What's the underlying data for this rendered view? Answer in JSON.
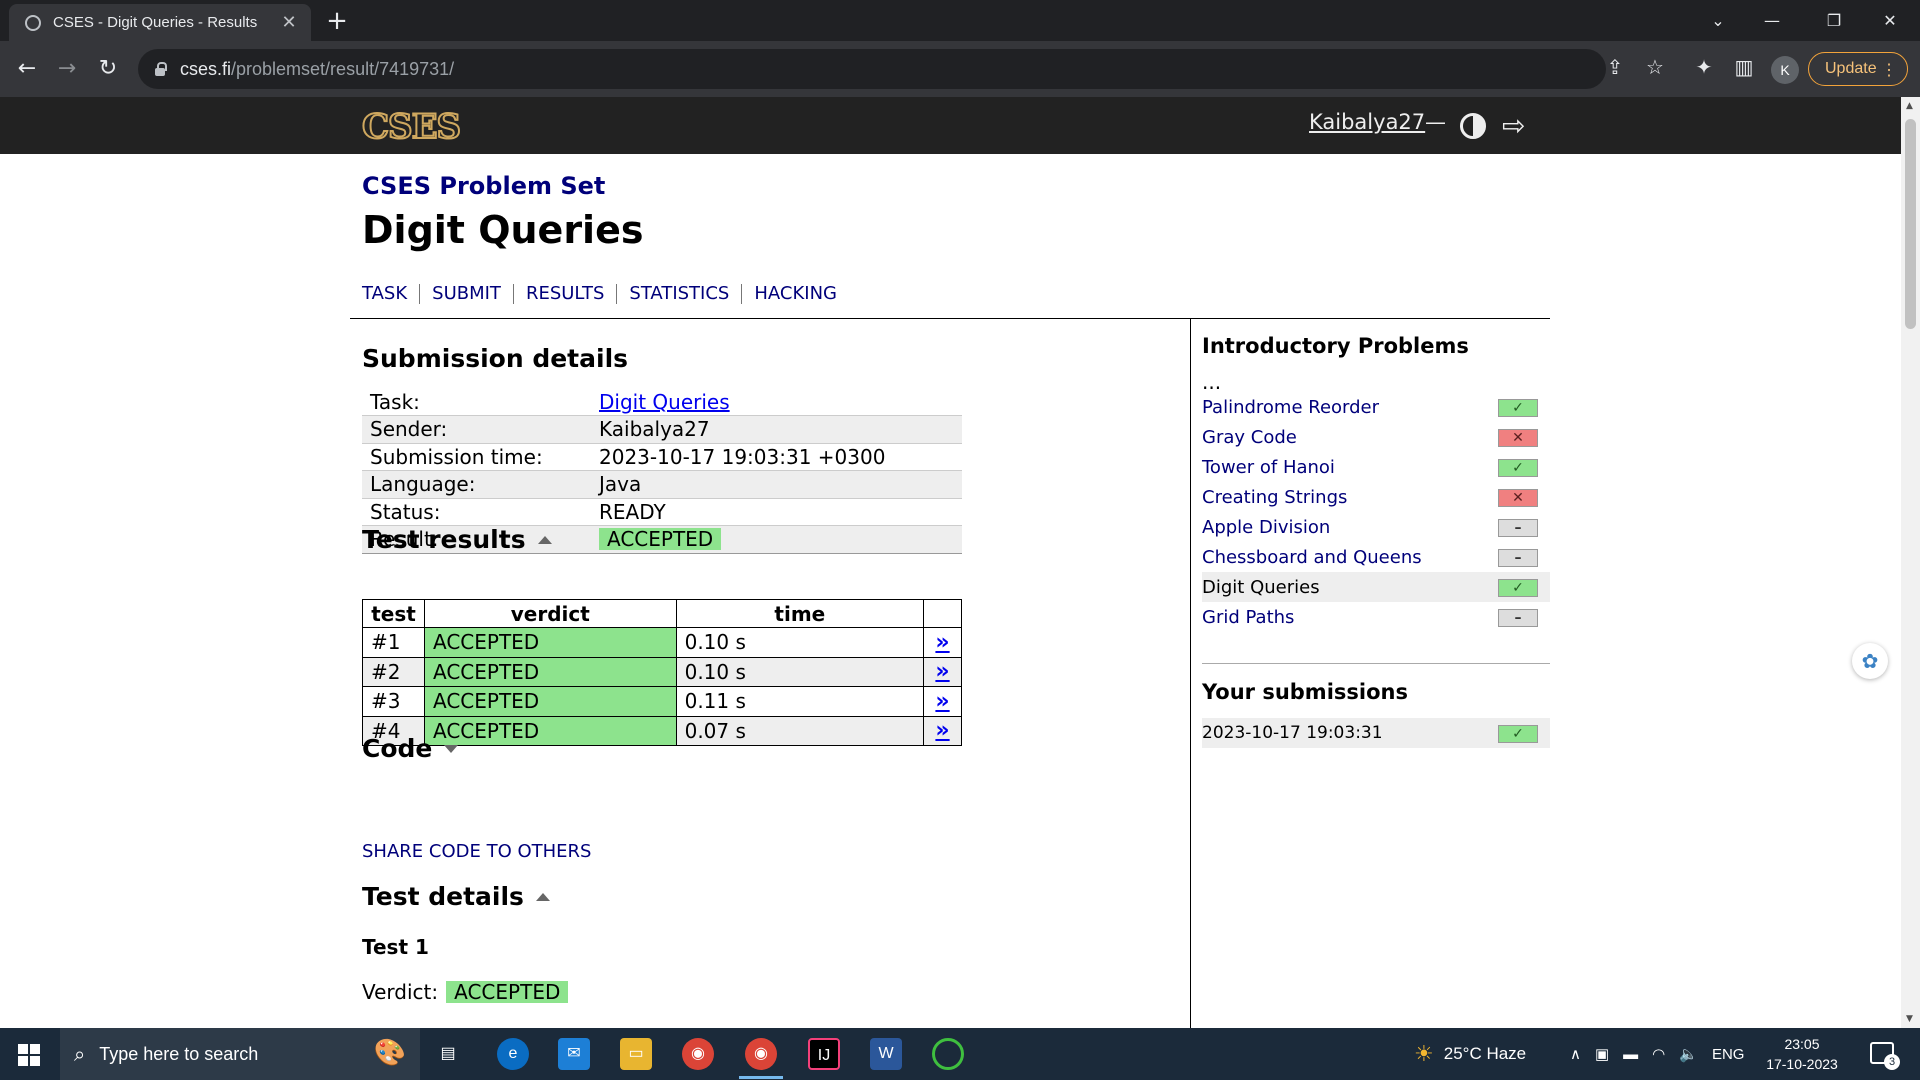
{
  "browser": {
    "tab_title": "CSES - Digit Queries - Results",
    "tab_close": "✕",
    "new_tab": "+",
    "url_host": "cses.fi",
    "url_path": "/problemset/result/7419731/",
    "profile_initial": "K",
    "update_label": "Update",
    "window_controls": {
      "dropdown": "⌄",
      "minimize": "—",
      "restore": "❐",
      "close": "✕"
    }
  },
  "site": {
    "logo": "CSES",
    "username": "Kaibalya27",
    "dash": "—"
  },
  "page": {
    "subtitle": "CSES Problem Set",
    "title": "Digit Queries",
    "tabs": [
      "TASK",
      "SUBMIT",
      "RESULTS",
      "STATISTICS",
      "HACKING"
    ]
  },
  "submission": {
    "heading": "Submission details",
    "rows": [
      {
        "label": "Task:",
        "value": "Digit Queries"
      },
      {
        "label": "Sender:",
        "value": "Kaibalya27"
      },
      {
        "label": "Submission time:",
        "value": "2023-10-17 19:03:31 +0300"
      },
      {
        "label": "Language:",
        "value": "Java"
      },
      {
        "label": "Status:",
        "value": "READY"
      },
      {
        "label": "Result:",
        "value": "ACCEPTED"
      }
    ]
  },
  "test_results": {
    "heading": "Test results",
    "columns": [
      "test",
      "verdict",
      "time"
    ],
    "rows": [
      {
        "test": "#1",
        "verdict": "ACCEPTED",
        "time": "0.10 s",
        "link": "»"
      },
      {
        "test": "#2",
        "verdict": "ACCEPTED",
        "time": "0.10 s",
        "link": "»"
      },
      {
        "test": "#3",
        "verdict": "ACCEPTED",
        "time": "0.11 s",
        "link": "»"
      },
      {
        "test": "#4",
        "verdict": "ACCEPTED",
        "time": "0.07 s",
        "link": "»"
      }
    ]
  },
  "code": {
    "heading": "Code",
    "share_label": "SHARE CODE TO OTHERS"
  },
  "test_details": {
    "heading": "Test details",
    "test_name": "Test 1",
    "verdict_label": "Verdict:",
    "verdict_value": "ACCEPTED"
  },
  "sidebar": {
    "section_title": "Introductory Problems",
    "ellipsis": "...",
    "problems": [
      {
        "name": "Palindrome Reorder",
        "status": "ok",
        "mark": "✓"
      },
      {
        "name": "Gray Code",
        "status": "fail",
        "mark": "✕"
      },
      {
        "name": "Tower of Hanoi",
        "status": "ok",
        "mark": "✓"
      },
      {
        "name": "Creating Strings",
        "status": "fail",
        "mark": "✕"
      },
      {
        "name": "Apple Division",
        "status": "none",
        "mark": "–"
      },
      {
        "name": "Chessboard and Queens",
        "status": "none",
        "mark": "–"
      },
      {
        "name": "Digit Queries",
        "status": "ok",
        "mark": "✓"
      },
      {
        "name": "Grid Paths",
        "status": "none",
        "mark": "–"
      }
    ],
    "submissions_title": "Your submissions",
    "submission_time": "2023-10-17 19:03:31",
    "submission_mark": "✓"
  },
  "taskbar": {
    "search_placeholder": "Type here to search",
    "weather": "25°C  Haze",
    "language": "ENG",
    "time": "23:05",
    "date": "17-10-2023",
    "notification_count": "3"
  },
  "colors": {
    "accepted": "#8de38d",
    "failed": "#f08080",
    "link": "#00007a",
    "header_bg": "#222222"
  }
}
